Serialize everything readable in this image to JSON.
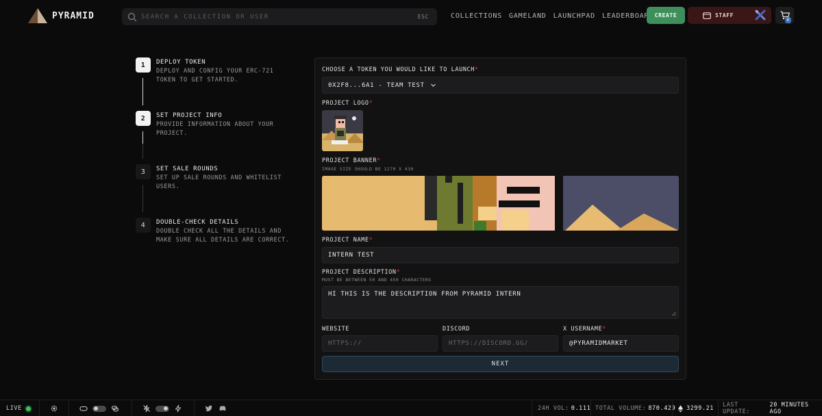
{
  "header": {
    "brand": "PYRAMID",
    "search_placeholder": "SEARCH A COLLECTION OR USER",
    "esc_hint": "ESC",
    "nav": [
      "COLLECTIONS",
      "GAMELAND",
      "LAUNCHPAD",
      "LEADERBOARD"
    ],
    "create_label": "CREATE",
    "staff_label": "STAFF",
    "cart_count": "0",
    "colors": {
      "create": "#3f8f5c",
      "staff": "#3a1616",
      "cart_badge": "#3a6fb6"
    }
  },
  "steps": [
    {
      "num": "1",
      "title": "DEPLOY TOKEN",
      "desc": "DEPLOY AND CONFIG YOUR ERC-721 TOKEN TO GET STARTED."
    },
    {
      "num": "2",
      "title": "SET PROJECT INFO",
      "desc": "PROVIDE INFORMATION ABOUT YOUR PROJECT."
    },
    {
      "num": "3",
      "title": "SET SALE ROUNDS",
      "desc": "SET UP SALE ROUNDS AND WHITELIST USERS."
    },
    {
      "num": "4",
      "title": "DOUBLE-CHECK DETAILS",
      "desc": "DOUBLE CHECK ALL THE DETAILS AND MAKE SURE ALL DETAILS ARE CORRECT."
    }
  ],
  "form": {
    "token_label": "CHOOSE A TOKEN YOU WOULD LIKE TO LAUNCH",
    "token_value": "0X2F8...6A1 - TEAM TEST",
    "logo_label": "PROJECT LOGO",
    "banner_label": "PROJECT BANNER",
    "banner_hint": "IMAGE SIZE SHOULD BE 1270 X 430",
    "name_label": "PROJECT NAME",
    "name_value": "INTERN TEST",
    "desc_label": "PROJECT DESCRIPTION",
    "desc_hint": "MUST BE BETWEEN 50 AND 450 CHARACTERS",
    "desc_value": "HI THIS IS THE DESCRIPTION FROM PYRAMID INTERN",
    "website_label": "WEBSITE",
    "website_placeholder": "HTTPS://",
    "discord_label": "DISCORD",
    "discord_placeholder": "HTTPS://DISCORD.GG/",
    "x_label": "X USERNAME",
    "x_value": "@PYRAMIDMARKET",
    "required_mark": "*",
    "next_label": "NEXT"
  },
  "footer": {
    "live_label": "LIVE",
    "vol_24h_label": "24H VOL:",
    "vol_24h_value": "0.111",
    "total_volume_label": "TOTAL VOLUME:",
    "total_volume_value": "870.429",
    "eth_price": "3299.21",
    "last_update_label": "LAST UPDATE:",
    "last_update_value": "20 MINUTES AGO"
  }
}
